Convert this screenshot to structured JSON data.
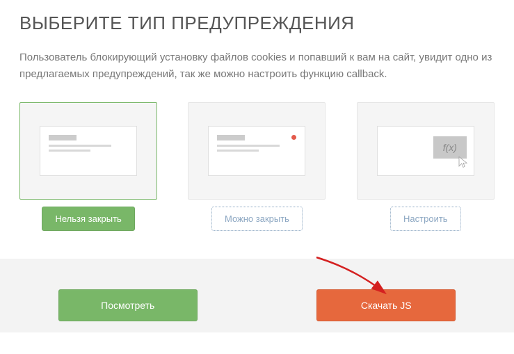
{
  "heading": "ВЫБЕРИТЕ ТИП ПРЕДУПРЕЖДЕНИЯ",
  "description": "Пользователь блокирующий установку файлов cookies и попавший к вам на сайт, увидит одно из предлагаемых предупреждений, так же можно настроить функцию callback.",
  "cards": {
    "cannot_close": {
      "label": "Нельзя закрыть"
    },
    "can_close": {
      "label": "Можно закрыть"
    },
    "configure": {
      "label": "Настроить",
      "fx": "f(x)"
    }
  },
  "footer": {
    "preview": "Посмотреть",
    "download": "Скачать JS"
  }
}
